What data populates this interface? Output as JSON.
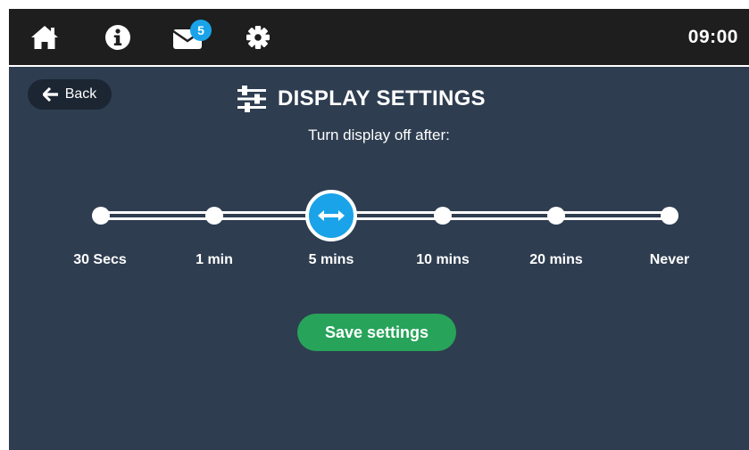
{
  "status_bar": {
    "icons": [
      "home-icon",
      "info-icon",
      "mail-icon",
      "gear-icon"
    ],
    "mail_badge_count": "5",
    "clock": "09:00"
  },
  "header": {
    "back_label": "Back",
    "title": "DISPLAY SETTINGS",
    "title_icon": "sliders-icon"
  },
  "settings": {
    "prompt": "Turn display off after:",
    "options": [
      "30 Secs",
      "1 min",
      "5 mins",
      "10 mins",
      "20 mins",
      "Never"
    ],
    "selected_option": "5 mins",
    "thumb_icon": "horizontal-arrows-icon"
  },
  "actions": {
    "save_label": "Save settings"
  },
  "colors": {
    "background": "#2e3d50",
    "top_bar": "#1e1e1f",
    "accent": "#1aa3e8",
    "save_button": "#27a35a",
    "back_button": "#1c2633"
  }
}
